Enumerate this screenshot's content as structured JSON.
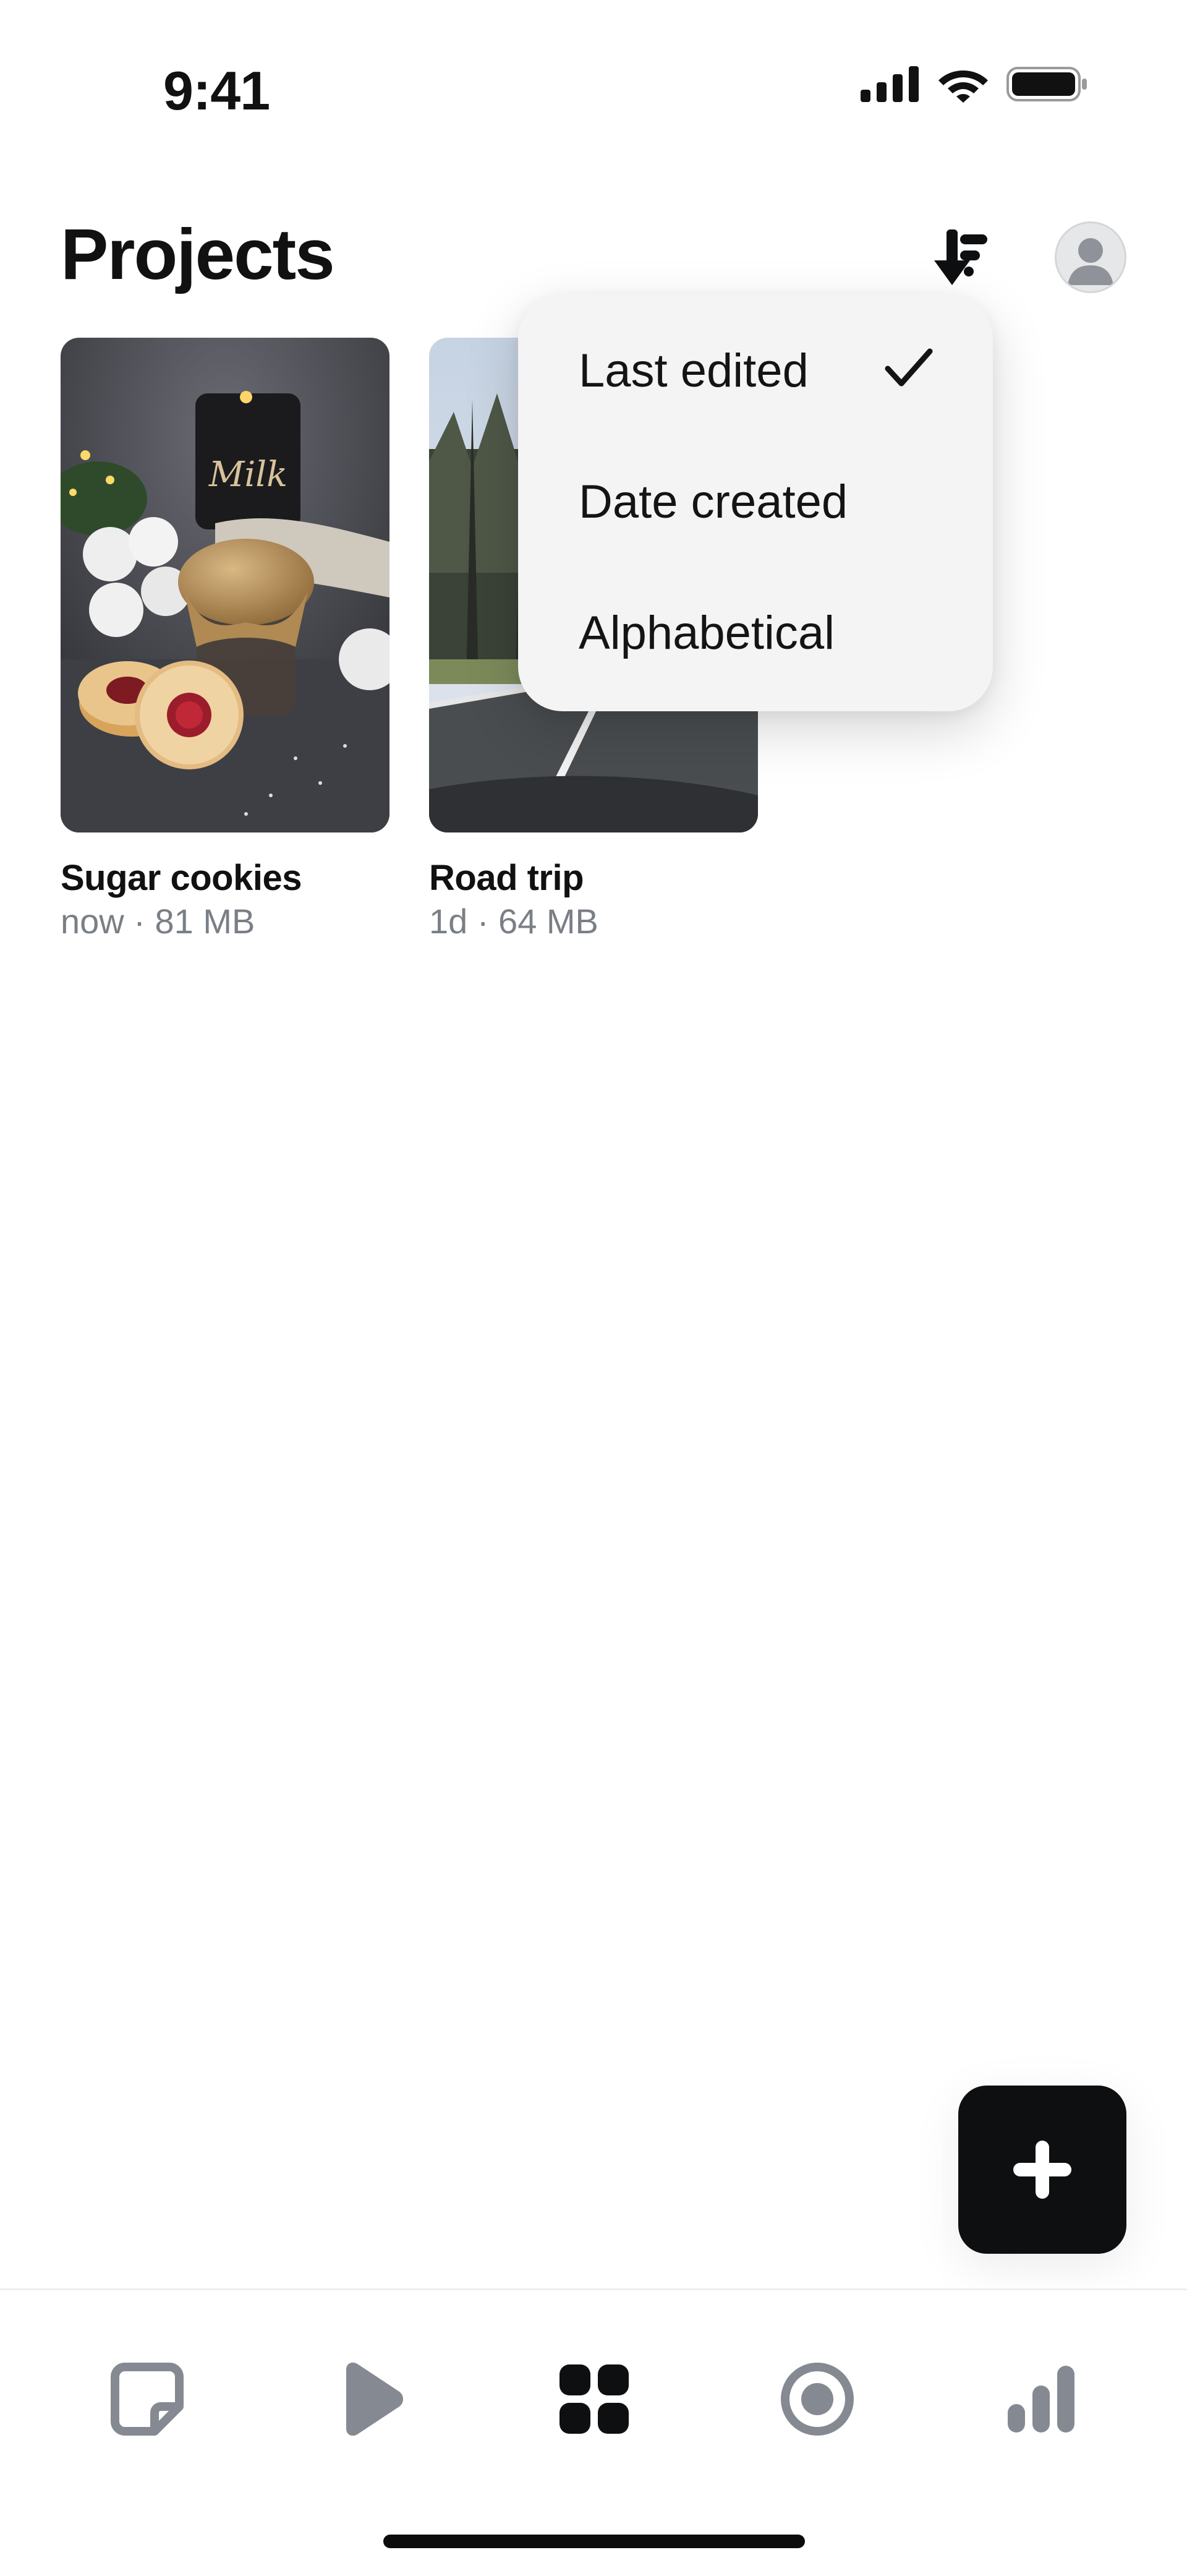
{
  "status_bar": {
    "time": "9:41"
  },
  "header": {
    "title": "Projects"
  },
  "sort_menu": {
    "selected": "Last edited",
    "options": [
      {
        "label": "Last edited",
        "checked": true
      },
      {
        "label": "Date created",
        "checked": false
      },
      {
        "label": "Alphabetical",
        "checked": false
      }
    ]
  },
  "projects": [
    {
      "name": "Sugar cookies",
      "meta": "now · 81 MB"
    },
    {
      "name": "Road trip",
      "meta": "1d · 64 MB"
    }
  ],
  "tab_bar": {
    "tabs": [
      {
        "icon": "sticker-icon",
        "active": false
      },
      {
        "icon": "play-icon",
        "active": false
      },
      {
        "icon": "grid-icon",
        "active": true
      },
      {
        "icon": "record-icon",
        "active": false
      },
      {
        "icon": "stats-icon",
        "active": false
      }
    ]
  },
  "colors": {
    "accent": "#0e0f11",
    "inactive_icon": "#858a92",
    "secondary_text": "#7a7f86"
  }
}
